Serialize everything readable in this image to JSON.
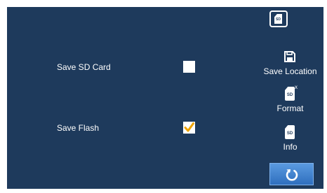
{
  "status": {
    "sd_badge_text": "SD",
    "icon": "sd-card-status-icon"
  },
  "options": [
    {
      "label": "Save SD Card",
      "checked": false
    },
    {
      "label": "Save Flash",
      "checked": true
    }
  ],
  "sidebar": {
    "save_location": {
      "label": "Save Location",
      "icon": "save-disk-icon"
    },
    "format": {
      "label": "Format",
      "icon": "sd-format-icon",
      "badge": "SD",
      "mark": "x"
    },
    "info": {
      "label": "Info",
      "icon": "sd-info-icon",
      "badge": "SD"
    },
    "back": {
      "icon": "back-refresh-icon"
    }
  },
  "colors": {
    "panel_bg": "#1e3a5c",
    "check_color": "#f0a400",
    "back_button": "#3b7fcf"
  }
}
